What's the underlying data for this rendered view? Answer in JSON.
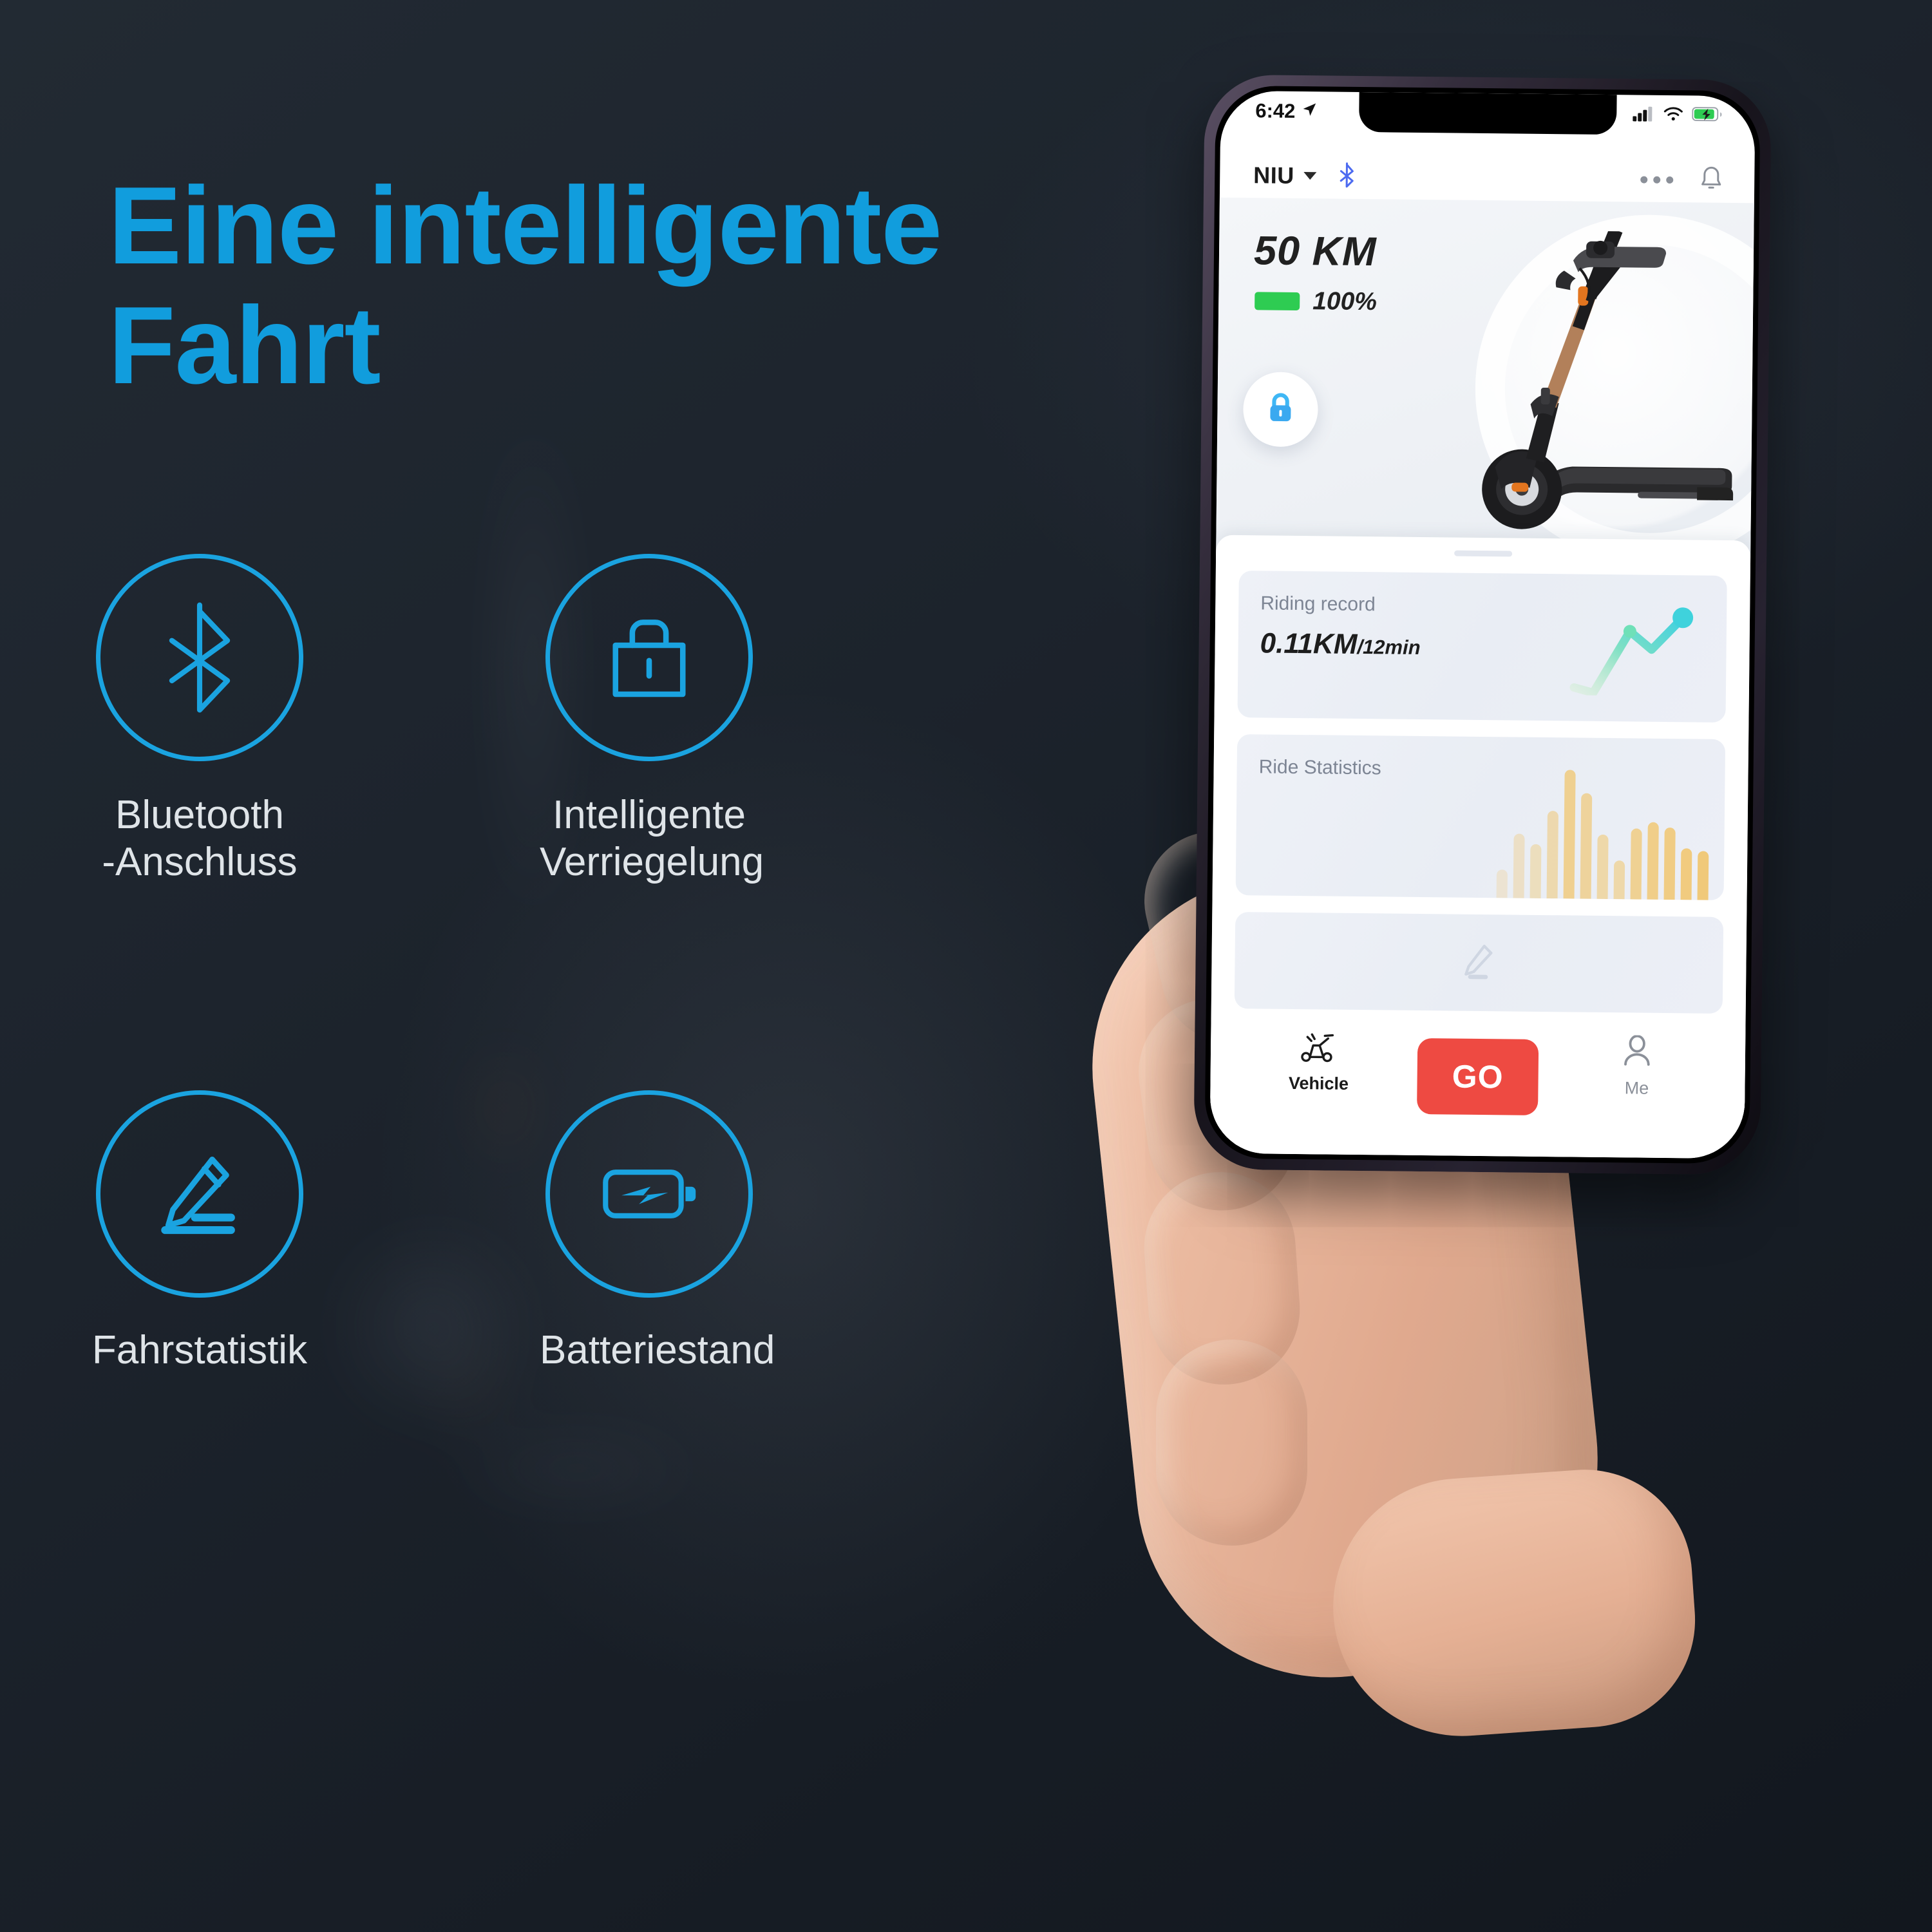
{
  "theme": {
    "accent": "#119ddd",
    "icon_stroke": "#1aa3e0",
    "bg_dark": "#1b222b",
    "go_red": "#ee4a42",
    "battery_green": "#2ecc52",
    "bar_amber": "#f0c97a"
  },
  "promo": {
    "headline": "Eine intelligente\nFahrt",
    "features": [
      {
        "icon": "bluetooth-icon",
        "label": "Bluetooth\n-Anschluss"
      },
      {
        "icon": "lock-icon",
        "label": "Intelligente\nVerriegelung"
      },
      {
        "icon": "pencil-stats-icon",
        "label": "Fahrstatistik"
      },
      {
        "icon": "battery-charge-icon",
        "label": "Batteriestand"
      }
    ]
  },
  "phone": {
    "status_bar": {
      "time": "6:42",
      "location_icon": "location-arrow-icon",
      "signal_icon": "cellular-signal-icon",
      "wifi_icon": "wifi-icon",
      "battery_icon": "battery-charging-icon"
    },
    "app_bar": {
      "brand": "NIU",
      "dropdown_icon": "chevron-down-icon",
      "bluetooth_icon": "bluetooth-icon",
      "more_icon": "more-dots-icon",
      "notification_icon": "bell-icon"
    },
    "hero": {
      "range": "50 KM",
      "battery_percent": "100%",
      "lock_icon": "lock-icon",
      "vehicle_image": "electric-scooter-image"
    },
    "cards": {
      "riding_record": {
        "label": "Riding record",
        "distance": "0.11KM",
        "duration": "/12min",
        "chart_icon": "sparkline-chart"
      },
      "ride_statistics": {
        "label": "Ride Statistics",
        "chart_icon": "bar-chart"
      },
      "edit_card": {
        "icon": "pencil-icon"
      }
    },
    "tabs": [
      {
        "icon": "scooter-icon",
        "label": "Vehicle",
        "active": true
      },
      {
        "icon": "go-button",
        "label": "GO",
        "active": false
      },
      {
        "icon": "person-icon",
        "label": "Me",
        "active": false
      }
    ]
  },
  "chart_data": [
    {
      "type": "line",
      "title": "Riding record",
      "x": [
        0,
        1,
        2,
        3,
        4
      ],
      "values": [
        8,
        2,
        64,
        40,
        88
      ],
      "ylim": [
        0,
        100
      ],
      "grid": false,
      "legend": "none",
      "annotations": [
        "0.11KM/12min"
      ]
    },
    {
      "type": "bar",
      "title": "Ride Statistics",
      "categories": [
        "1",
        "2",
        "3",
        "4",
        "5",
        "6",
        "7",
        "8",
        "9",
        "10",
        "11",
        "12",
        "13"
      ],
      "values": [
        22,
        50,
        42,
        68,
        100,
        82,
        50,
        30,
        55,
        60,
        56,
        40,
        38
      ],
      "ylim": [
        0,
        100
      ],
      "grid": false,
      "legend": "none"
    }
  ]
}
